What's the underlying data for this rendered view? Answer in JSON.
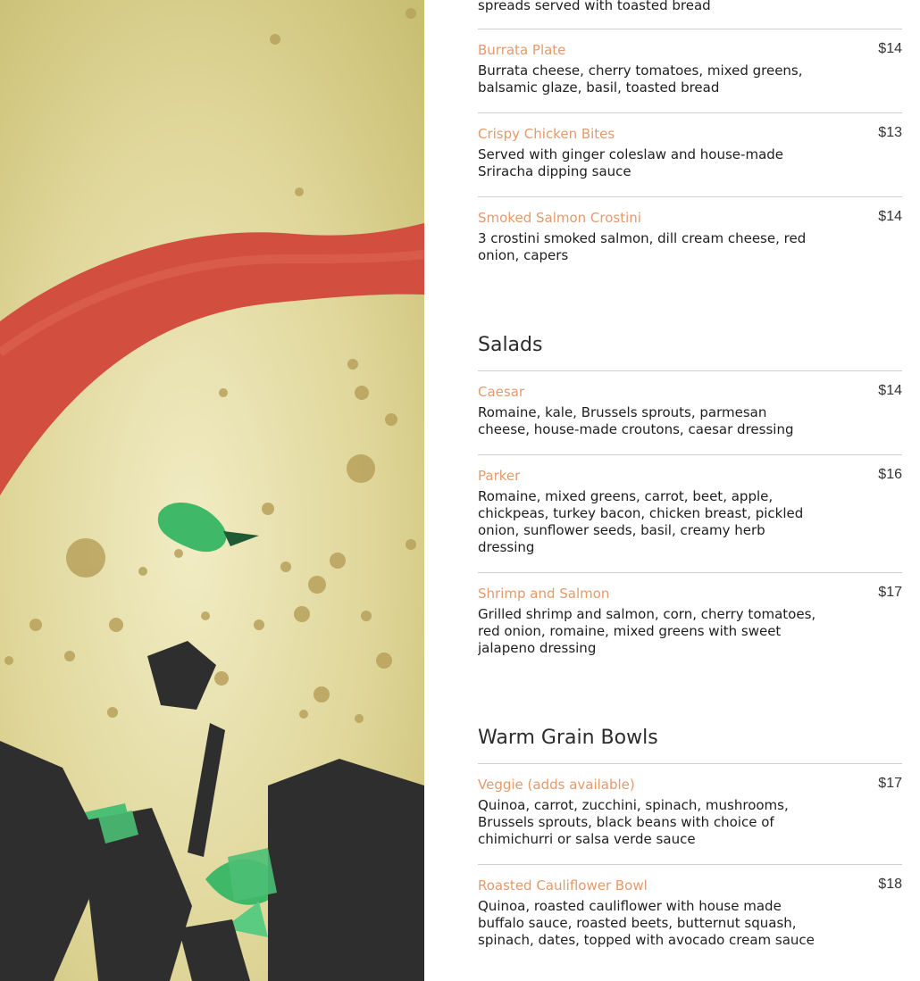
{
  "hero_image": {
    "icon": "food-photo-soup-closeup",
    "colors": {
      "base": "#dcd28e",
      "sauce": "#d7503f",
      "herb": "#3fb968",
      "char": "#2b2b2b"
    }
  },
  "menu": {
    "top_fragment": "spreads served with toasted bread",
    "starters": [
      {
        "name": "Burrata Plate",
        "price": "$14",
        "desc": "Burrata cheese, cherry tomatoes, mixed greens, balsamic glaze, basil, toasted bread"
      },
      {
        "name": "Crispy Chicken Bites",
        "price": "$13",
        "desc": "Served with ginger coleslaw and house-made Sriracha dipping sauce"
      },
      {
        "name": "Smoked Salmon Crostini",
        "price": "$14",
        "desc": "3 crostini smoked salmon, dill cream cheese, red onion, capers"
      }
    ],
    "salads": {
      "title": "Salads",
      "items": [
        {
          "name": "Caesar",
          "price": "$14",
          "desc": "Romaine, kale, Brussels sprouts, parmesan cheese, house-made croutons, caesar dressing"
        },
        {
          "name": "Parker",
          "price": "$16",
          "desc": "Romaine, mixed greens, carrot, beet, apple, chickpeas, turkey bacon, chicken breast, pickled onion, sunflower seeds, basil, creamy herb dressing"
        },
        {
          "name": "Shrimp and Salmon",
          "price": "$17",
          "desc": "Grilled shrimp and salmon, corn, cherry tomatoes, red onion, romaine, mixed greens with sweet jalapeno dressing"
        }
      ]
    },
    "bowls": {
      "title": "Warm Grain Bowls",
      "items": [
        {
          "name": "Veggie (adds available)",
          "price": "$17",
          "desc": "Quinoa, carrot, zucchini, spinach, mushrooms, Brussels sprouts, black beans with choice of chimichurri or salsa verde sauce"
        },
        {
          "name": "Roasted Cauliflower Bowl",
          "price": "$18",
          "desc": "Quinoa, roasted cauliflower with house made buffalo sauce, roasted beets, butternut squash, spinach, dates, topped with avocado cream sauce"
        }
      ]
    },
    "colors": {
      "item_name": "#e39a6c",
      "text": "#1e1e1e",
      "rule": "#cfcfcf"
    }
  }
}
